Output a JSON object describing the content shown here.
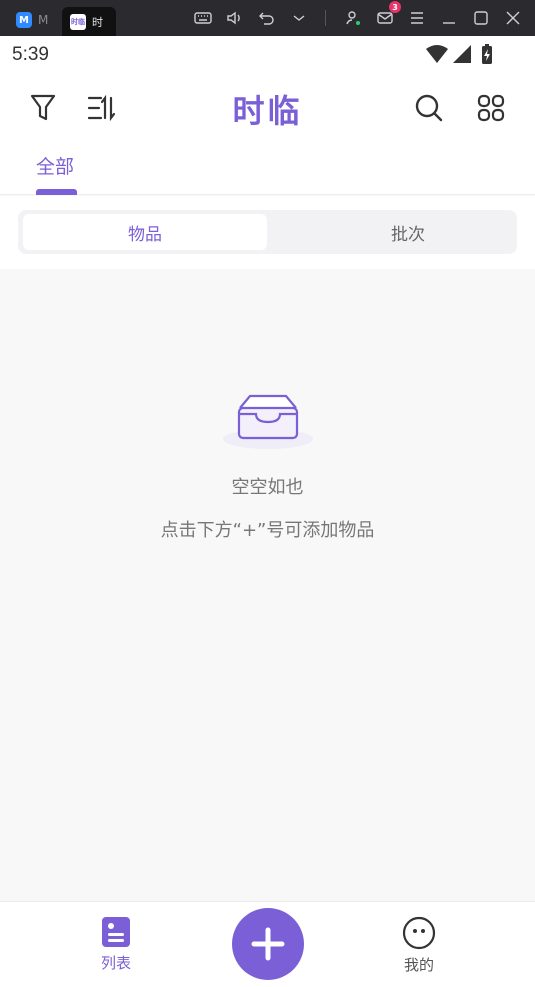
{
  "emulator": {
    "tab1_label": "M",
    "tab2_label": "时",
    "tab2_logo": "时临",
    "mail_badge": "3"
  },
  "status_bar": {
    "time": "5:39"
  },
  "header": {
    "title": "时临",
    "icons": [
      "filter-icon",
      "sort-icon",
      "search-icon",
      "grid-icon"
    ]
  },
  "category_tabs": [
    {
      "label": "全部",
      "active": true
    }
  ],
  "segment": {
    "items": [
      {
        "label": "物品",
        "active": true
      },
      {
        "label": "批次",
        "active": false
      }
    ]
  },
  "empty_state": {
    "title": "空空如也",
    "hint": "点击下方“+”号可添加物品"
  },
  "bottom_nav": {
    "list_label": "列表",
    "me_label": "我的"
  },
  "colors": {
    "accent": "#7b5fd6",
    "background": "#f8f8f8"
  }
}
